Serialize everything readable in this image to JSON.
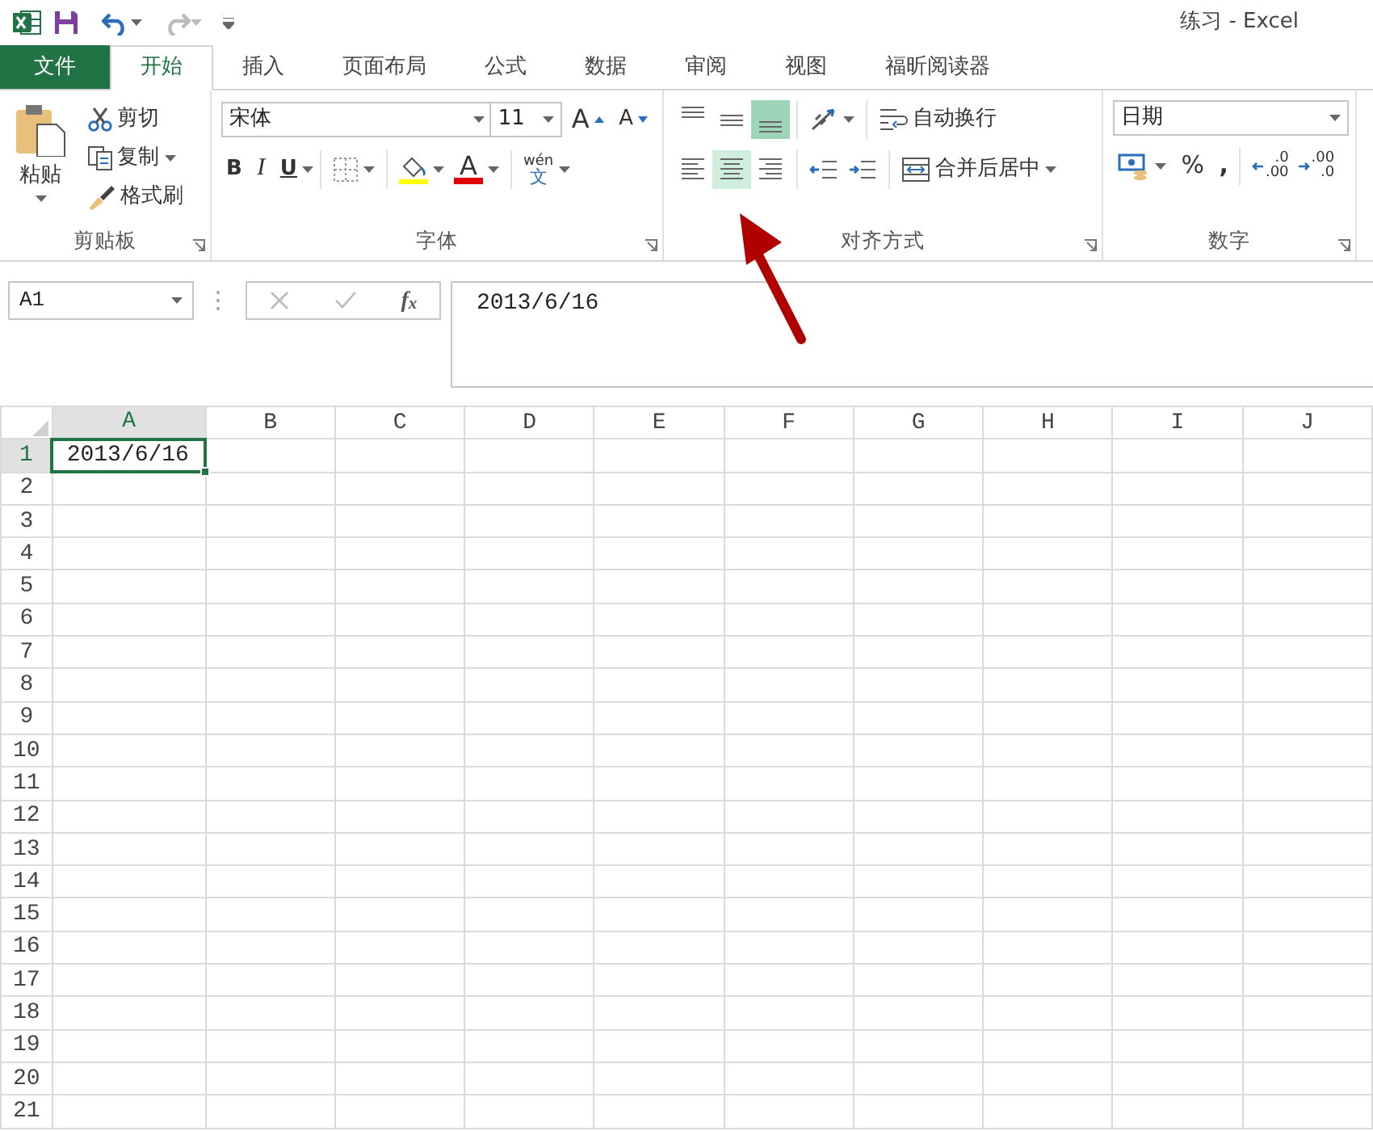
{
  "title_bar": {
    "title": "练习 - Excel"
  },
  "tabs": [
    {
      "label": "文件",
      "kind": "file",
      "selected": false
    },
    {
      "label": "开始",
      "kind": "tab",
      "selected": true
    },
    {
      "label": "插入",
      "kind": "tab",
      "selected": false
    },
    {
      "label": "页面布局",
      "kind": "tab",
      "selected": false
    },
    {
      "label": "公式",
      "kind": "tab",
      "selected": false
    },
    {
      "label": "数据",
      "kind": "tab",
      "selected": false
    },
    {
      "label": "审阅",
      "kind": "tab",
      "selected": false
    },
    {
      "label": "视图",
      "kind": "tab",
      "selected": false
    },
    {
      "label": "福昕阅读器",
      "kind": "tab",
      "selected": false
    }
  ],
  "ribbon": {
    "clipboard": {
      "label": "剪贴板",
      "paste": "粘贴",
      "cut": "剪切",
      "copy": "复制",
      "format_painter": "格式刷"
    },
    "font": {
      "label": "字体",
      "font_name": "宋体",
      "font_size": "11",
      "grow": "A",
      "shrink": "A",
      "bold": "B",
      "italic": "I",
      "underline": "U",
      "font_color": "A",
      "phonetic": "wén",
      "phonetic_char": "文"
    },
    "alignment": {
      "label": "对齐方式",
      "vertical": [
        {
          "kind": "top",
          "selected": false
        },
        {
          "kind": "middle",
          "selected": false
        },
        {
          "kind": "bottom",
          "selected": true
        }
      ],
      "horizontal": [
        {
          "kind": "left",
          "hovered": false
        },
        {
          "kind": "center",
          "hovered": true
        },
        {
          "kind": "right",
          "hovered": false
        }
      ],
      "wrap_text": "自动换行",
      "merge": "合并后居中"
    },
    "number": {
      "label": "数字",
      "format": "日期",
      "percent": "%",
      "comma": ",",
      "increase_decimal": [
        ".0",
        ".00"
      ],
      "decrease_decimal": [
        ".00",
        ".0"
      ]
    }
  },
  "formula_bar": {
    "name_box": "A1",
    "fx": "f$_{x}$",
    "formula": "2013/6/16"
  },
  "sheet": {
    "columns": [
      {
        "label": "A",
        "selected": true
      },
      {
        "label": "B",
        "selected": false
      },
      {
        "label": "C",
        "selected": false
      },
      {
        "label": "D",
        "selected": false
      },
      {
        "label": "E",
        "selected": false
      },
      {
        "label": "F",
        "selected": false
      },
      {
        "label": "G",
        "selected": false
      },
      {
        "label": "H",
        "selected": false
      },
      {
        "label": "I",
        "selected": false
      },
      {
        "label": "J",
        "selected": false
      }
    ],
    "rows": [
      {
        "label": "1",
        "selected": true,
        "cells": [
          {
            "value": "2013/6/16",
            "selected": true
          }
        ]
      },
      {
        "label": "2",
        "selected": false
      },
      {
        "label": "3",
        "selected": false
      },
      {
        "label": "4",
        "selected": false
      },
      {
        "label": "5",
        "selected": false
      },
      {
        "label": "6",
        "selected": false
      },
      {
        "label": "7",
        "selected": false
      },
      {
        "label": "8",
        "selected": false
      },
      {
        "label": "9",
        "selected": false
      },
      {
        "label": "10",
        "selected": false
      },
      {
        "label": "11",
        "selected": false
      },
      {
        "label": "12",
        "selected": false
      },
      {
        "label": "13",
        "selected": false
      },
      {
        "label": "14",
        "selected": false
      },
      {
        "label": "15",
        "selected": false
      },
      {
        "label": "16",
        "selected": false
      },
      {
        "label": "17",
        "selected": false
      },
      {
        "label": "18",
        "selected": false
      },
      {
        "label": "19",
        "selected": false
      },
      {
        "label": "20",
        "selected": false
      },
      {
        "label": "21",
        "selected": false
      }
    ]
  }
}
